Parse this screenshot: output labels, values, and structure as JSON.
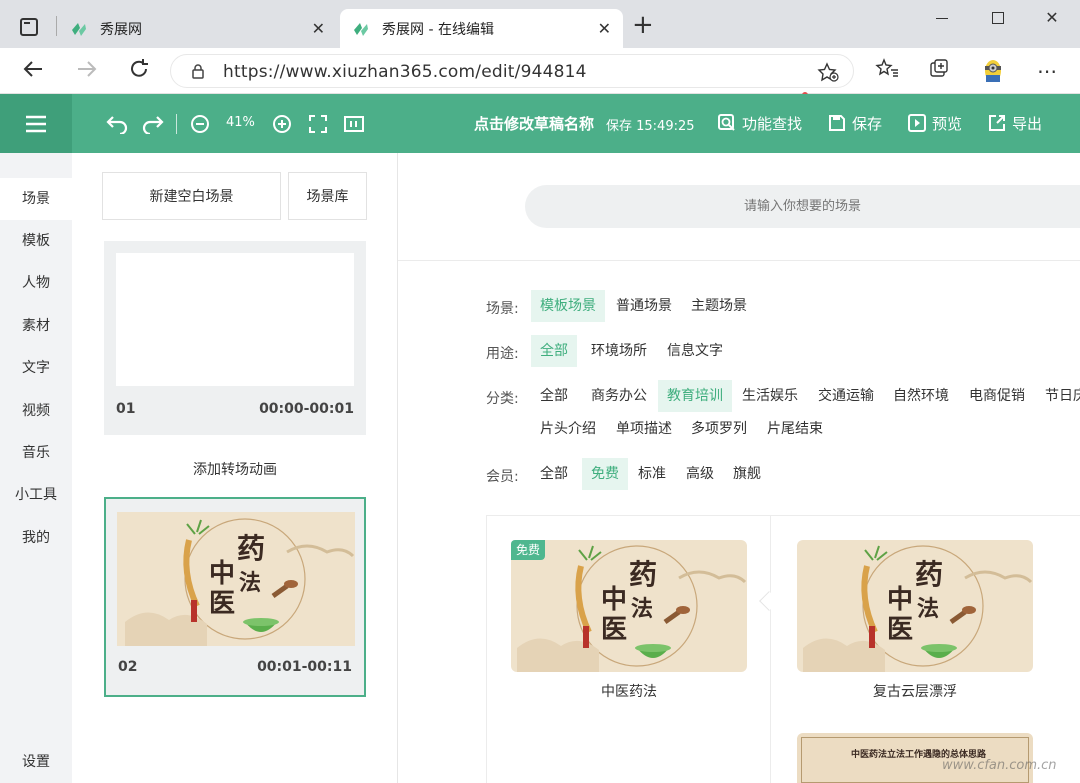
{
  "browser": {
    "tabs": [
      {
        "title": "秀展网"
      },
      {
        "title": "秀展网 - 在线编辑"
      }
    ],
    "new_tab": "+",
    "url": "https://www.xiuzhan365.com/edit/944814"
  },
  "toolbar": {
    "zoom": "41%",
    "draft_title": "点击修改草稿名称",
    "save_status": "保存 15:49:25",
    "find_label": "功能查找",
    "save_label": "保存",
    "preview_label": "预览",
    "export_label": "导出"
  },
  "leftnav": {
    "items": [
      {
        "label": "场景"
      },
      {
        "label": "模板"
      },
      {
        "label": "人物"
      },
      {
        "label": "素材"
      },
      {
        "label": "文字"
      },
      {
        "label": "视频"
      },
      {
        "label": "音乐"
      },
      {
        "label": "小工具"
      },
      {
        "label": "我的"
      }
    ],
    "settings": "设置"
  },
  "scenes": {
    "new_blank": "新建空白场景",
    "library": "场景库",
    "add_transition": "添加转场动画",
    "items": [
      {
        "num": "01",
        "time": "00:00-00:01"
      },
      {
        "num": "02",
        "time": "00:01-00:11"
      }
    ]
  },
  "search": {
    "placeholder": "请输入你想要的场景"
  },
  "filters": {
    "scene_label": "场景:",
    "scene_options": [
      "模板场景",
      "普通场景",
      "主题场景"
    ],
    "use_label": "用途:",
    "use_options": [
      "全部",
      "环境场所",
      "信息文字"
    ],
    "category_label": "分类:",
    "category_options": [
      "全部",
      "商务办公",
      "教育培训",
      "生活娱乐",
      "交通运输",
      "自然环境",
      "电商促销",
      "节日庆"
    ],
    "category_options_2": [
      "片头介绍",
      "单项描述",
      "多项罗列",
      "片尾结束"
    ],
    "member_label": "会员:",
    "member_options": [
      "全部",
      "免费",
      "标准",
      "高级",
      "旗舰"
    ]
  },
  "thumb_text": {
    "line1": "药",
    "line2": "法",
    "line3": "中",
    "line4": "医",
    "banner": "中医药法立法工作遇隐的总体思路"
  },
  "results": {
    "free_badge": "免费",
    "items": [
      {
        "title": "中医药法"
      },
      {
        "title": "复古云层漂浮"
      }
    ]
  },
  "watermark": "www.cfan.com.cn",
  "colors": {
    "brand_green": "#4caf89",
    "accent_green": "#3fae7e"
  }
}
